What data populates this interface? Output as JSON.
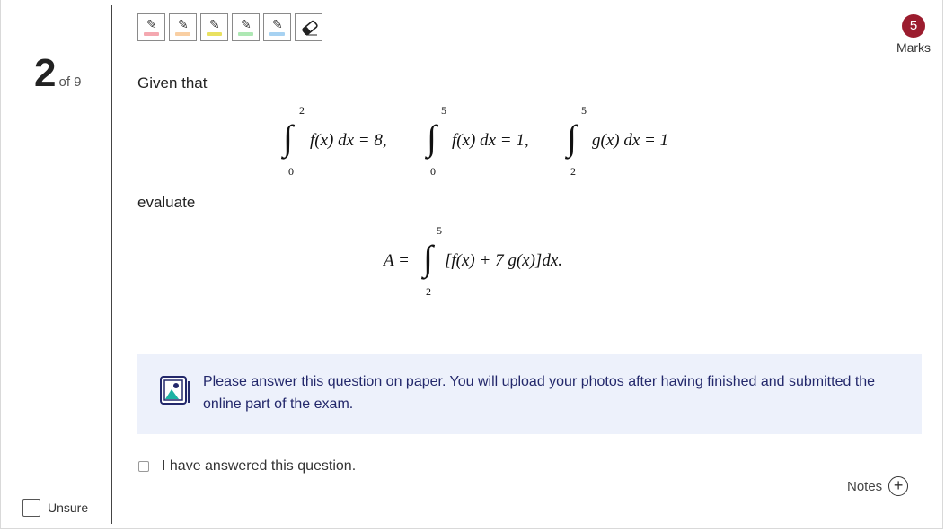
{
  "question": {
    "number": "2",
    "of_label": "of 9"
  },
  "unsure": {
    "label": "Unsure"
  },
  "marks": {
    "value": "5",
    "label": "Marks"
  },
  "toolbar": {
    "highlighters": [
      {
        "name": "red",
        "color": "#f4a8b0"
      },
      {
        "name": "orange",
        "color": "#f9cfa3"
      },
      {
        "name": "yellow",
        "color": "#e9e160"
      },
      {
        "name": "green",
        "color": "#aee8b4"
      },
      {
        "name": "blue",
        "color": "#a7d2f2"
      }
    ],
    "eraser_icon": "eraser-icon",
    "pen_icon": "pencil-icon"
  },
  "body": {
    "given_label": "Given that",
    "evaluate_label": "evaluate",
    "integrals": [
      {
        "lower": "0",
        "upper": "2",
        "expr": "f(x) dx = 8,"
      },
      {
        "lower": "0",
        "upper": "5",
        "expr": "f(x) dx = 1,"
      },
      {
        "lower": "2",
        "upper": "5",
        "expr": "g(x) dx = 1"
      }
    ],
    "target": {
      "lhs": "A =",
      "lower": "2",
      "upper": "5",
      "expr": "[f(x) + 7 g(x)]dx."
    }
  },
  "notice": {
    "icon": "photo-upload-icon",
    "text": "Please answer this question on paper. You will upload your photos after having finished and submitted the online part of the exam."
  },
  "answered": {
    "label": "I have answered this question."
  },
  "notes": {
    "label": "Notes",
    "icon": "plus-circle-icon"
  }
}
